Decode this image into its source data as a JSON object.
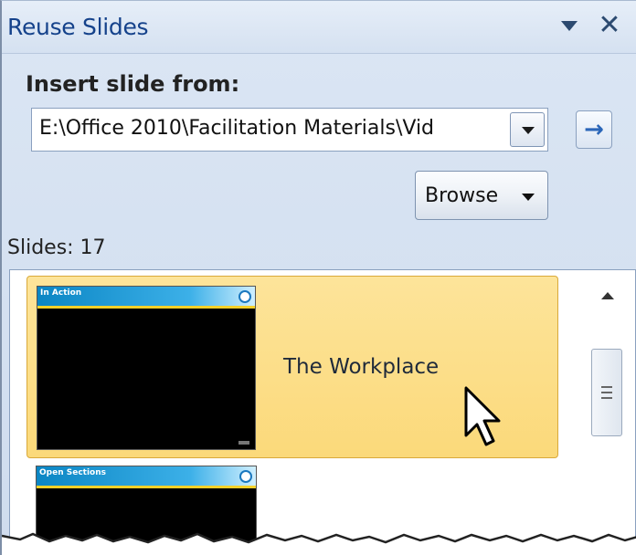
{
  "pane": {
    "title": "Reuse Slides",
    "menu_icon": "dropdown-triangle",
    "close_icon": "close-x",
    "close_glyph": "✕"
  },
  "insert": {
    "label": "Insert slide from:",
    "path_value": "E:\\Office 2010\\Facilitation Materials\\Vid",
    "go_glyph": "→"
  },
  "browse": {
    "label": "Browse"
  },
  "slides": {
    "count_label": "Slides: 17",
    "items": [
      {
        "name": "The Workplace",
        "thumb_header": "In Action",
        "selected": true
      },
      {
        "name": "",
        "thumb_header": "Open Sections",
        "selected": false
      }
    ]
  },
  "colors": {
    "title_text": "#15428b",
    "selected_item_bg": "#fbd97a",
    "accent_blue": "#2b66b8"
  }
}
